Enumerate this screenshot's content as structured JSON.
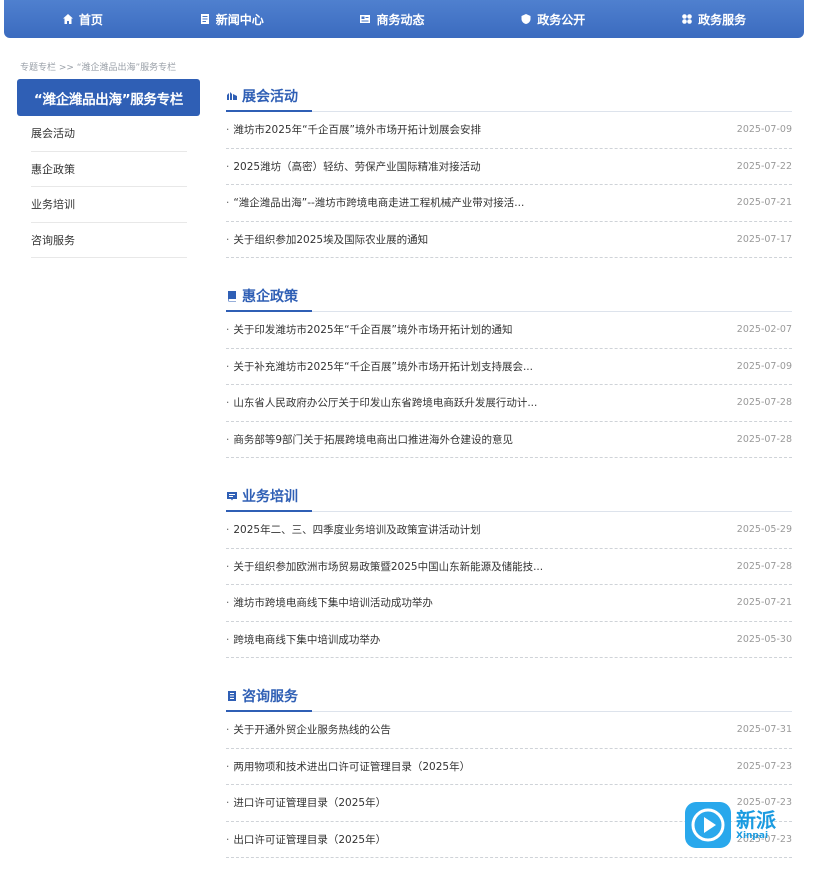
{
  "nav": {
    "items": [
      {
        "label": "首页",
        "icon": "home-icon"
      },
      {
        "label": "新闻中心",
        "icon": "document-icon"
      },
      {
        "label": "商务动态",
        "icon": "news-icon"
      },
      {
        "label": "政务公开",
        "icon": "badge-icon"
      },
      {
        "label": "政务服务",
        "icon": "grid-icon"
      }
    ]
  },
  "breadcrumb": "专题专栏 >> “潍企潍品出海”服务专栏",
  "sidebar": {
    "title": "“潍企潍品出海”服务专栏",
    "items": [
      {
        "label": "展会活动"
      },
      {
        "label": "惠企政策"
      },
      {
        "label": "业务培训"
      },
      {
        "label": "咨询服务"
      }
    ]
  },
  "sections": [
    {
      "title": "展会活动",
      "icon": "expo-icon",
      "items": [
        {
          "title": "潍坊市2025年“千企百展”境外市场开拓计划展会安排",
          "date": "2025-07-09"
        },
        {
          "title": "2025潍坊（高密）轻纺、劳保产业国际精准对接活动",
          "date": "2025-07-22"
        },
        {
          "title": "“潍企潍品出海”--潍坊市跨境电商走进工程机械产业带对接活...",
          "date": "2025-07-21"
        },
        {
          "title": "关于组织参加2025埃及国际农业展的通知",
          "date": "2025-07-17"
        }
      ]
    },
    {
      "title": "惠企政策",
      "icon": "book-icon",
      "items": [
        {
          "title": "关于印发潍坊市2025年“千企百展”境外市场开拓计划的通知",
          "date": "2025-02-07"
        },
        {
          "title": "关于补充潍坊市2025年“千企百展”境外市场开拓计划支持展会...",
          "date": "2025-07-09"
        },
        {
          "title": "山东省人民政府办公厅关于印发山东省跨境电商跃升发展行动计...",
          "date": "2025-07-28"
        },
        {
          "title": "商务部等9部门关于拓展跨境电商出口推进海外仓建设的意见",
          "date": "2025-07-28"
        }
      ]
    },
    {
      "title": "业务培训",
      "icon": "training-icon",
      "items": [
        {
          "title": "2025年二、三、四季度业务培训及政策宣讲活动计划",
          "date": "2025-05-29"
        },
        {
          "title": "关于组织参加欧洲市场贸易政策暨2025中国山东新能源及储能技...",
          "date": "2025-07-28"
        },
        {
          "title": "潍坊市跨境电商线下集中培训活动成功举办",
          "date": "2025-07-21"
        },
        {
          "title": "跨境电商线下集中培训成功举办",
          "date": "2025-05-30"
        }
      ]
    },
    {
      "title": "咨询服务",
      "icon": "consult-icon",
      "items": [
        {
          "title": "关于开通外贸企业服务热线的公告",
          "date": "2025-07-31"
        },
        {
          "title": "两用物项和技术进出口许可证管理目录（2025年）",
          "date": "2025-07-23"
        },
        {
          "title": "进口许可证管理目录（2025年）",
          "date": "2025-07-23"
        },
        {
          "title": "出口许可证管理目录（2025年）",
          "date": "2025-07-23"
        }
      ]
    }
  ],
  "watermark": {
    "cn": "新派",
    "en": "Xinpai"
  }
}
